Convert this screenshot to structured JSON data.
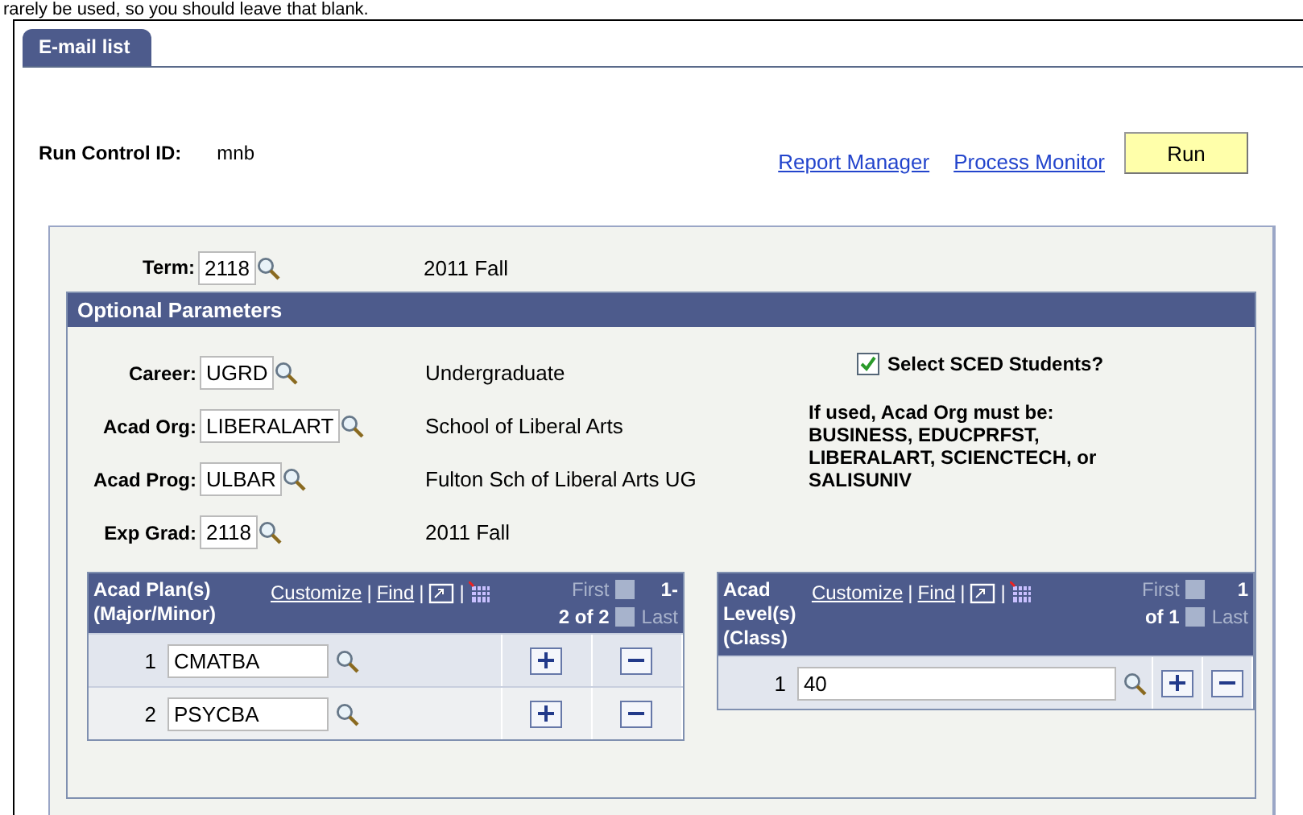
{
  "caption": "rarely be used, so you should leave that blank.",
  "tabs": [
    {
      "label": "E-mail list",
      "selected": true
    }
  ],
  "run_control": {
    "label": "Run Control ID:",
    "value": "mnb"
  },
  "links": [
    "Report Manager",
    "Process Monitor"
  ],
  "run_button": "Run",
  "term": {
    "label": "Term:",
    "value": "2118",
    "description": "2011 Fall"
  },
  "optional": {
    "title": "Optional Parameters",
    "fields": [
      {
        "label": "Career:",
        "value": "UGRD",
        "description": "Undergraduate"
      },
      {
        "label": "Acad Org:",
        "value": "LIBERALART",
        "description": "School of Liberal Arts"
      },
      {
        "label": "Acad Prog:",
        "value": "ULBAR",
        "description": "Fulton Sch of Liberal Arts UG"
      },
      {
        "label": "Exp Grad:",
        "value": "2118",
        "description": "2011 Fall"
      }
    ],
    "sced": {
      "label": "Select SCED Students?",
      "checked": true
    },
    "note": "If used, Acad Org must be: BUSINESS, EDUCPRFST, LIBERALART, SCIENCTECH, or SALISUNIV"
  },
  "grids": [
    {
      "title": "Acad Plan(s) (Major/Minor)",
      "customize": "Customize",
      "separators": [
        "|",
        "|",
        "|"
      ],
      "find": "Find",
      "first": "First",
      "range_start": "1-",
      "range_end": "2 of 2",
      "last": "Last",
      "rows": [
        {
          "num": "1",
          "value": "CMATBA"
        },
        {
          "num": "2",
          "value": "PSYCBA"
        }
      ]
    },
    {
      "title": "Acad Level(s) (Class)",
      "customize": "Customize",
      "separators": [
        "|",
        "|",
        "|"
      ],
      "find": "Find",
      "first": "First",
      "range_start": "1",
      "range_end": "of 1",
      "last": "Last",
      "rows": [
        {
          "num": "1",
          "value": "40"
        }
      ]
    }
  ]
}
